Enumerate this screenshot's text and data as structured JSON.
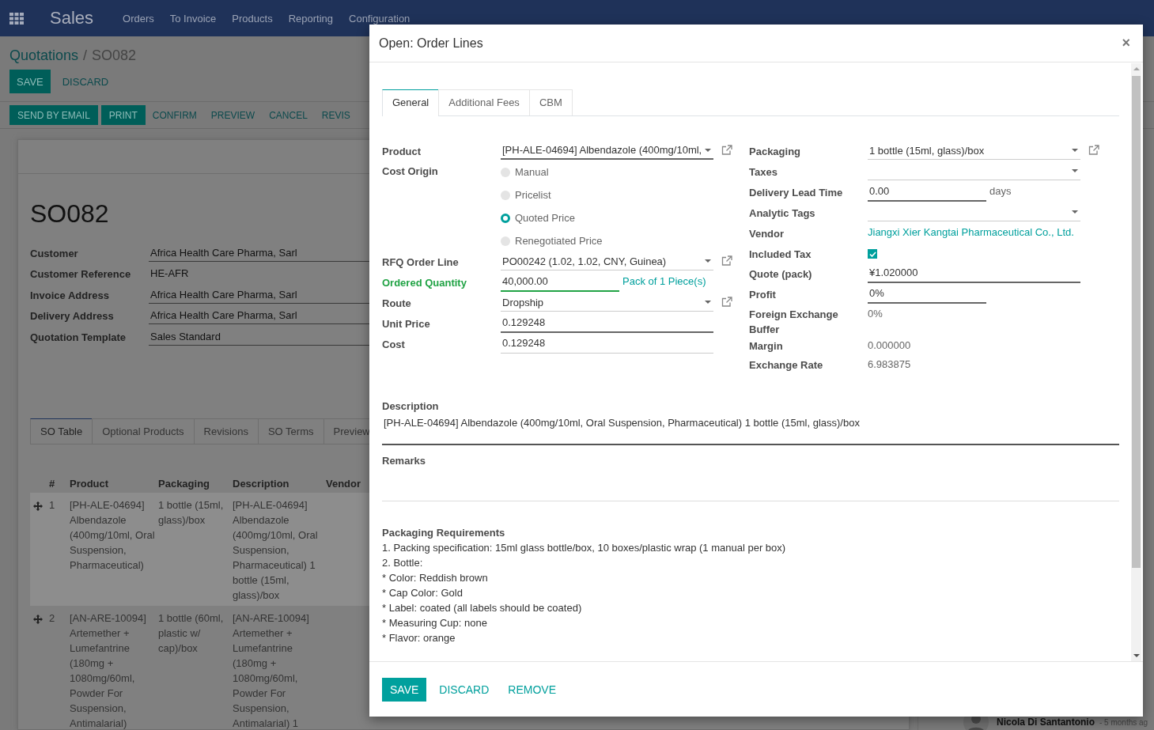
{
  "navbar": {
    "app": "Sales",
    "menu": [
      "Orders",
      "To Invoice",
      "Products",
      "Reporting",
      "Configuration"
    ]
  },
  "breadcrumb": {
    "items": [
      "Quotations",
      "SO082"
    ],
    "separator": "/"
  },
  "form_buttons": [
    {
      "label": "SAVE",
      "kind": "primary"
    },
    {
      "label": "DISCARD",
      "kind": "link"
    }
  ],
  "status_buttons": [
    {
      "label": "SEND BY EMAIL",
      "kind": "primary"
    },
    {
      "label": "PRINT",
      "kind": "primary"
    },
    {
      "label": "CONFIRM",
      "kind": "link"
    },
    {
      "label": "PREVIEW",
      "kind": "link"
    },
    {
      "label": "CANCEL",
      "kind": "link"
    },
    {
      "label": "REVIS",
      "kind": "link"
    }
  ],
  "record": {
    "name": "SO082",
    "fields": [
      {
        "label": "Customer",
        "value": "Africa Health Care Pharma, Sarl",
        "kind": "select"
      },
      {
        "label": "Customer Reference",
        "value": "HE-AFR",
        "kind": "text"
      },
      {
        "label": "Invoice Address",
        "value": "Africa Health Care Pharma, Sarl",
        "kind": "select"
      },
      {
        "label": "Delivery Address",
        "value": "Africa Health Care Pharma, Sarl",
        "kind": "select"
      },
      {
        "label": "Quotation Template",
        "value": "Sales Standard",
        "kind": "select"
      }
    ]
  },
  "notebook": {
    "tabs": [
      {
        "label": "SO Table",
        "selected": true
      },
      {
        "label": "Optional Products",
        "selected": false
      },
      {
        "label": "Revisions",
        "selected": false
      },
      {
        "label": "SO Terms",
        "selected": false
      },
      {
        "label": "Preview",
        "selected": false
      }
    ],
    "table": {
      "columns": [
        "#",
        "Product",
        "Packaging",
        "Description",
        "Vendor"
      ],
      "rows": [
        {
          "number": "1",
          "product": "[PH-ALE-04694] Albendazole (400mg/10ml, Oral Suspension, Pharmaceutical)",
          "packaging": "1 bottle (15ml, glass)/box",
          "description": "[PH-ALE-04694] Albendazole (400mg/10ml, Oral Suspension, Pharmaceutical) 1 bottle (15ml, glass)/box",
          "highlighted": true
        },
        {
          "number": "2",
          "product": "[AN-ARE-10094] Artemether + Lumefantrine (180mg + 1080mg/60ml, Powder For Suspension, Antimalarial)",
          "packaging": "1 bottle (60ml, plastic w/ cap)/box",
          "description": "[AN-ARE-10094] Artemether + Lumefantrine (180mg + 1080mg/60ml, Powder For Suspension, Antimalarial) 1",
          "highlighted": false
        }
      ]
    }
  },
  "activity": {
    "author": "Nicola Di Santantonio",
    "time": "- 5 months ag"
  },
  "dialog": {
    "title": "Open: Order Lines",
    "close": "×",
    "tabs": [
      {
        "label": "General",
        "selected": true
      },
      {
        "label": "Additional Fees",
        "selected": false
      },
      {
        "label": "CBM",
        "selected": false
      }
    ],
    "left_fields": [
      {
        "label": "Product",
        "kind": "select",
        "value": "[PH-ALE-04694] Albendazole (400mg/10ml,",
        "required": true,
        "external": true
      },
      {
        "label": "Cost Origin",
        "kind": "radio",
        "options": [
          {
            "label": "Manual",
            "selected": false
          },
          {
            "label": "Pricelist",
            "selected": false
          },
          {
            "label": "Quoted Price",
            "selected": true
          },
          {
            "label": "Renegotiated Price",
            "selected": false
          }
        ]
      },
      {
        "label": "RFQ Order Line",
        "kind": "select",
        "value": "PO00242 (1.02, 1.02, CNY, Guinea)",
        "required": false,
        "external": true
      },
      {
        "label": "Ordered Quantity",
        "kind": "quantity",
        "value": "40,000.00",
        "unit": "Pack of 1 Piece(s)",
        "unit_link": true,
        "highlight": true,
        "required": true
      },
      {
        "label": "Route",
        "kind": "select",
        "value": "Dropship",
        "required": false,
        "external": true
      },
      {
        "label": "Unit Price",
        "kind": "input",
        "value": "0.129248",
        "required": true
      },
      {
        "label": "Cost",
        "kind": "input",
        "value": "0.129248",
        "required": false
      }
    ],
    "right_fields": [
      {
        "label": "Packaging",
        "kind": "select",
        "value": "1 bottle (15ml, glass)/box",
        "required": false,
        "external": true
      },
      {
        "label": "Taxes",
        "kind": "select",
        "required": false,
        "external": false
      },
      {
        "label": "Delivery Lead Time",
        "kind": "quantity",
        "value": "0.00",
        "unit": "days",
        "unit_link": false,
        "highlight": false,
        "required": true
      },
      {
        "label": "Analytic Tags",
        "kind": "select",
        "required": false,
        "external": false
      },
      {
        "label": "Vendor",
        "kind": "link",
        "value": "Jiangxi Xier Kangtai Pharmaceutical Co., Ltd."
      },
      {
        "label": "Included Tax",
        "kind": "checkbox",
        "checked": true
      },
      {
        "label": "Quote (pack)",
        "kind": "input",
        "value": "¥1.020000",
        "required": true
      },
      {
        "label": "Profit",
        "kind": "input",
        "value": "0%",
        "required": true,
        "short": true
      },
      {
        "label": "Foreign Exchange Buffer",
        "kind": "readonly",
        "value": "0%"
      },
      {
        "label": "Margin",
        "kind": "readonly",
        "value": "0.000000"
      },
      {
        "label": "Exchange Rate",
        "kind": "readonly",
        "value": "6.983875"
      }
    ],
    "description": {
      "label": "Description",
      "text": "[PH-ALE-04694] Albendazole (400mg/10ml, Oral Suspension, Pharmaceutical) 1 bottle (15ml, glass)/box"
    },
    "remarks": {
      "label": "Remarks"
    },
    "packaging_requirements": {
      "label": "Packaging Requirements",
      "lines": [
        "1. Packing specification: 15ml glass bottle/box, 10 boxes/plastic wrap (1 manual per box)",
        "2. Bottle:",
        "* Color:  Reddish brown",
        "* Cap Color: Gold",
        "* Label: coated (all labels should be coated)",
        "* Measuring Cup: none",
        "* Flavor: orange"
      ]
    },
    "footer_buttons": [
      {
        "label": "SAVE",
        "kind": "primary"
      },
      {
        "label": "DISCARD",
        "kind": "link"
      },
      {
        "label": "REMOVE",
        "kind": "link"
      }
    ]
  }
}
